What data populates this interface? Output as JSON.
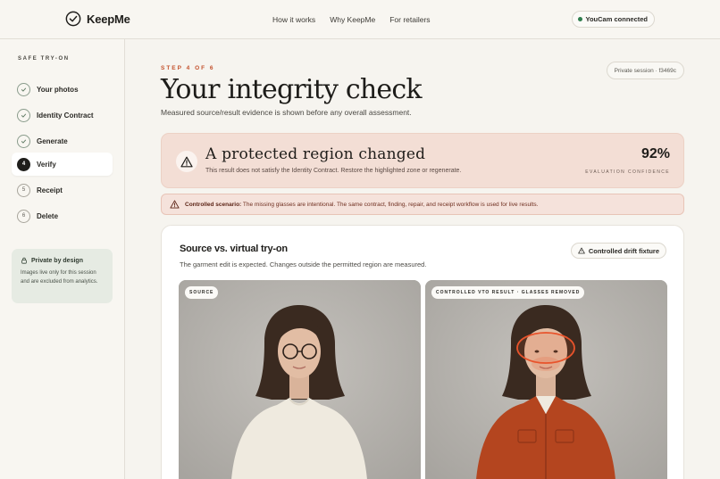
{
  "header": {
    "brand": "KeepMe",
    "nav": [
      "How it works",
      "Why KeepMe",
      "For retailers"
    ],
    "connection_status": "YouCam connected"
  },
  "sidebar": {
    "title": "SAFE TRY-ON",
    "steps": [
      {
        "number": "1",
        "label": "Your photos",
        "status": "done"
      },
      {
        "number": "2",
        "label": "Identity Contract",
        "status": "done"
      },
      {
        "number": "3",
        "label": "Generate",
        "status": "done"
      },
      {
        "number": "4",
        "label": "Verify",
        "status": "current"
      },
      {
        "number": "5",
        "label": "Receipt",
        "status": "pending"
      },
      {
        "number": "6",
        "label": "Delete",
        "status": "pending"
      }
    ],
    "privacy": {
      "title": "Private by design",
      "body": "Images live only for this session and are excluded from analytics."
    }
  },
  "main": {
    "eyebrow": "STEP 4 OF 6",
    "session": "Private session · f3469c",
    "title": "Your integrity check",
    "subtitle": "Measured source/result evidence is shown before any overall assessment.",
    "alert": {
      "title": "A protected region changed",
      "description": "This result does not satisfy the Identity Contract. Restore the highlighted zone or regenerate.",
      "confidence": "92%",
      "confidence_label": "EVALUATION CONFIDENCE"
    },
    "scenario": {
      "label": "Controlled scenario:",
      "text": "The missing glasses are intentional. The same contract, finding, repair, and receipt workflow is used for live results."
    },
    "comparison": {
      "title": "Source vs. virtual try-on",
      "subtitle": "The garment edit is expected. Changes outside the permitted region are measured.",
      "fixture_label": "Controlled drift fixture",
      "source_tag": "SOURCE",
      "result_tag": "CONTROLLED VTO RESULT · GLASSES REMOVED"
    }
  },
  "colors": {
    "accent": "#c3502b",
    "alert_bg": "#f3ded5",
    "highlight": "#e8532b"
  }
}
